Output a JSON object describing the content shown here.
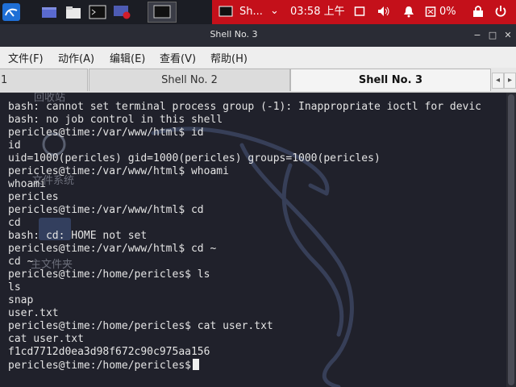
{
  "taskbar": {
    "app_label": "Sh...",
    "clock": "03:58 上午",
    "battery": "0%"
  },
  "window": {
    "title": "Shell No. 3",
    "minimize": "−",
    "maximize": "□",
    "close": "✕"
  },
  "menu": [
    {
      "label": "文件(F)"
    },
    {
      "label": "动作(A)"
    },
    {
      "label": "编辑(E)"
    },
    {
      "label": "查看(V)"
    },
    {
      "label": "帮助(H)"
    }
  ],
  "tabs": [
    {
      "label": "1"
    },
    {
      "label": "Shell No. 2"
    },
    {
      "label": "Shell No. 3",
      "active": true
    }
  ],
  "desktop_ghost_labels": [
    "回收站",
    "文件系统",
    "主文件夹"
  ],
  "terminal": {
    "lines": [
      "bash: cannot set terminal process group (-1): Inappropriate ioctl for devic",
      "bash: no job control in this shell",
      "pericles@time:/var/www/html$ id",
      "id",
      "uid=1000(pericles) gid=1000(pericles) groups=1000(pericles)",
      "pericles@time:/var/www/html$ whoami",
      "whoami",
      "pericles",
      "pericles@time:/var/www/html$ cd",
      "cd",
      "bash: cd: HOME not set",
      "pericles@time:/var/www/html$ cd ~",
      "cd ~",
      "pericles@time:/home/pericles$ ls",
      "ls",
      "snap",
      "user.txt",
      "pericles@time:/home/pericles$ cat user.txt",
      "cat user.txt",
      "f1cd7712d0ea3d98f672c90c975aa156",
      "pericles@time:/home/pericles$"
    ]
  },
  "colors": {
    "taskbar": "#1b1d24",
    "tray": "#c4101a",
    "terminal_bg": "#20212b",
    "terminal_fg": "#e4e4e4"
  }
}
